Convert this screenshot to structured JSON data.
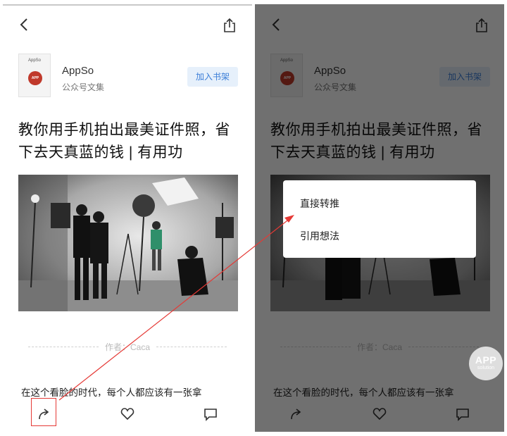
{
  "header": {
    "back_icon": "chevron-left-icon",
    "share_icon": "share-upload-icon"
  },
  "book": {
    "cover_title": "AppSo",
    "cover_logo_text": "APP",
    "author_name": "AppSo",
    "author_subtitle": "公众号文集",
    "shelf_button_label": "加入书架"
  },
  "article": {
    "title": "教你用手机拍出最美证件照，省下去天真蓝的钱 | 有用功",
    "byline": "作者：Caca",
    "body_snippet": "在这个看脸的时代，每个人都应该有一张拿"
  },
  "toolbar": {
    "repost_icon": "repost-arrow-icon",
    "like_icon": "heart-icon",
    "comment_icon": "comment-icon"
  },
  "popup": {
    "items": [
      "直接转推",
      "引用想法"
    ]
  },
  "watermark": {
    "main": "APP",
    "sub": "solution"
  },
  "colors": {
    "accent_blue": "#3b7ed8",
    "shelf_bg": "#e6f0fb",
    "annotation_red": "#e53935",
    "overlay": "rgba(0,0,0,0.56)"
  }
}
